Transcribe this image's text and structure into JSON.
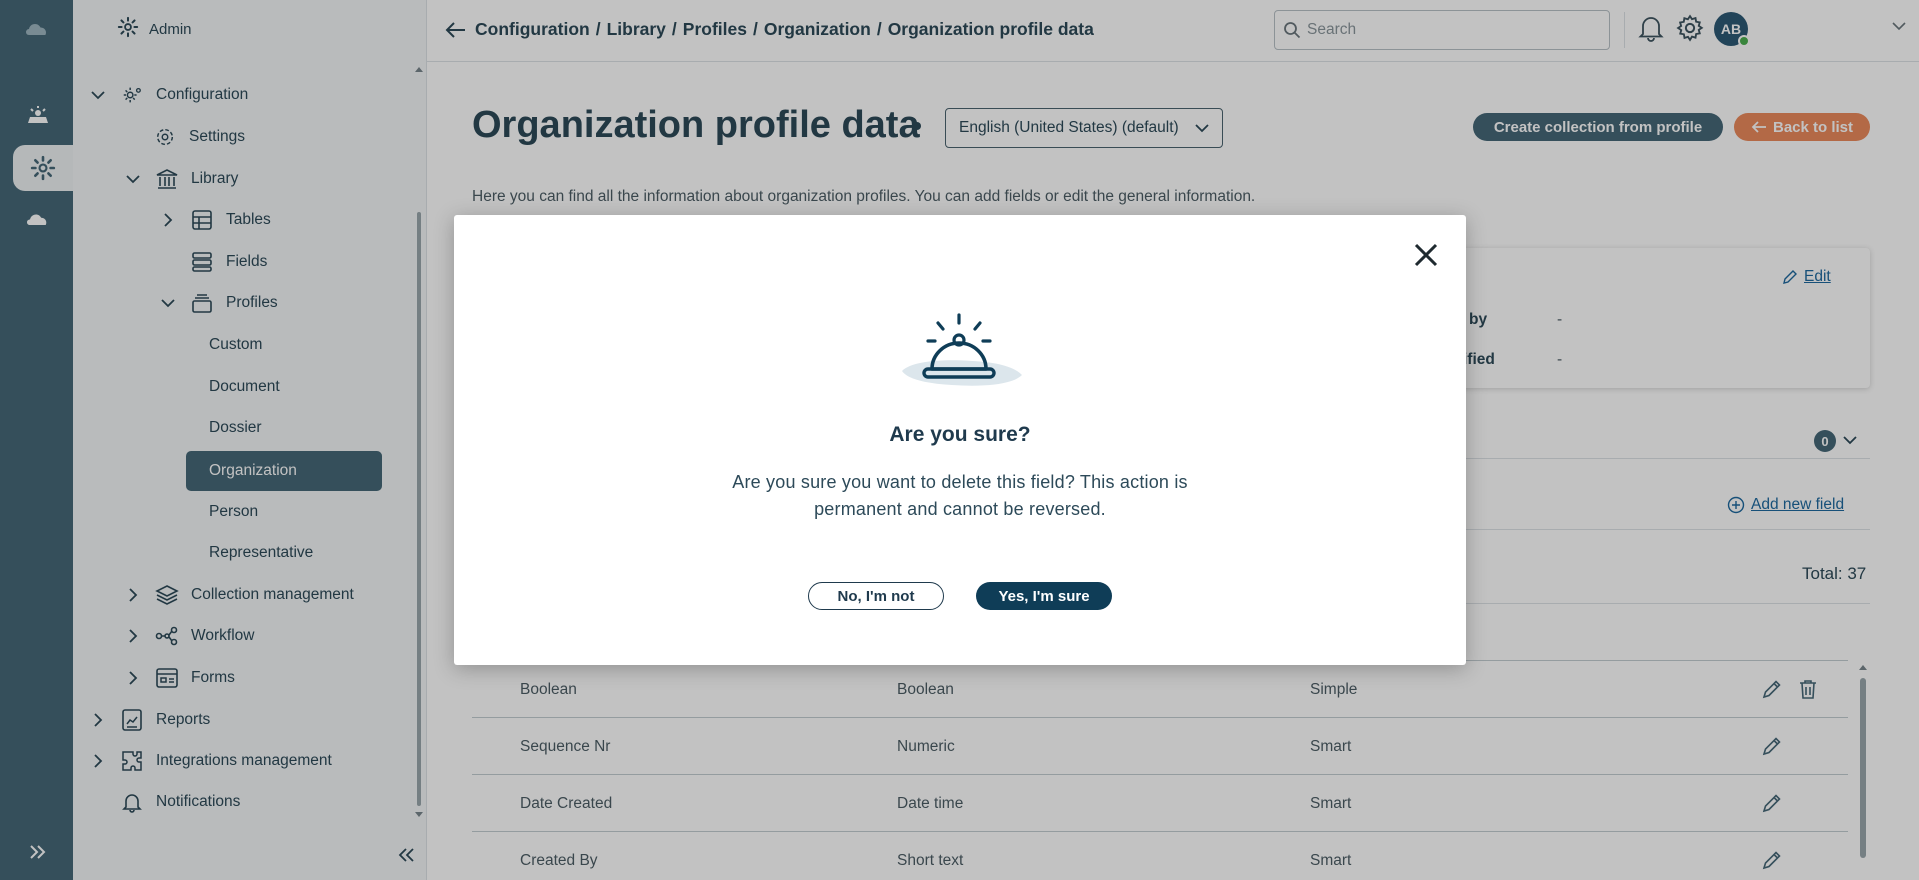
{
  "sidebar": {
    "header": "Admin",
    "items": [
      {
        "label": "Configuration"
      },
      {
        "label": "Settings"
      },
      {
        "label": "Library"
      },
      {
        "label": "Tables"
      },
      {
        "label": "Fields"
      },
      {
        "label": "Profiles"
      },
      {
        "label": "Collection management"
      },
      {
        "label": "Workflow"
      },
      {
        "label": "Forms"
      },
      {
        "label": "Reports"
      },
      {
        "label": "Integrations management"
      },
      {
        "label": "Notifications"
      }
    ],
    "profiles": [
      "Custom",
      "Document",
      "Dossier",
      "Organization",
      "Person",
      "Representative"
    ],
    "active_profile": "Organization"
  },
  "header": {
    "breadcrumb": [
      "Configuration",
      "Library",
      "Profiles",
      "Organization",
      "Organization profile data"
    ],
    "breadcrumb_separator": "/",
    "search_placeholder": "Search",
    "avatar_initials": "AB"
  },
  "page": {
    "title": "Organization profile data",
    "language": "English (United States) (default)",
    "create_button": "Create collection from profile",
    "back_button": "Back to list",
    "description": "Here you can find all the information about organization profiles. You can add fields or edit the general information.",
    "edit_label": "Edit",
    "info_fragments": [
      {
        "label": "by",
        "value": "-"
      },
      {
        "label": "ified",
        "value": "-"
      }
    ],
    "section_count": "0",
    "add_field_label": "Add new field",
    "total": "Total: 37"
  },
  "table": {
    "rows": [
      {
        "name": "Boolean",
        "type": "Boolean",
        "kind": "Simple",
        "deletable": true
      },
      {
        "name": "Sequence Nr",
        "type": "Numeric",
        "kind": "Smart",
        "deletable": false
      },
      {
        "name": "Date Created",
        "type": "Date time",
        "kind": "Smart",
        "deletable": false
      },
      {
        "name": "Created By",
        "type": "Short text",
        "kind": "Smart",
        "deletable": false
      }
    ]
  },
  "modal": {
    "title": "Are you sure?",
    "message": "Are you sure you want to delete this field? This action is permanent and cannot be reversed.",
    "no_label": "No, I'm not",
    "yes_label": "Yes, I'm sure"
  },
  "colors": {
    "brand": "#466878",
    "accent_orange": "#ec8a5c",
    "confirm": "#0f3d57",
    "link": "#1f6aa0"
  }
}
